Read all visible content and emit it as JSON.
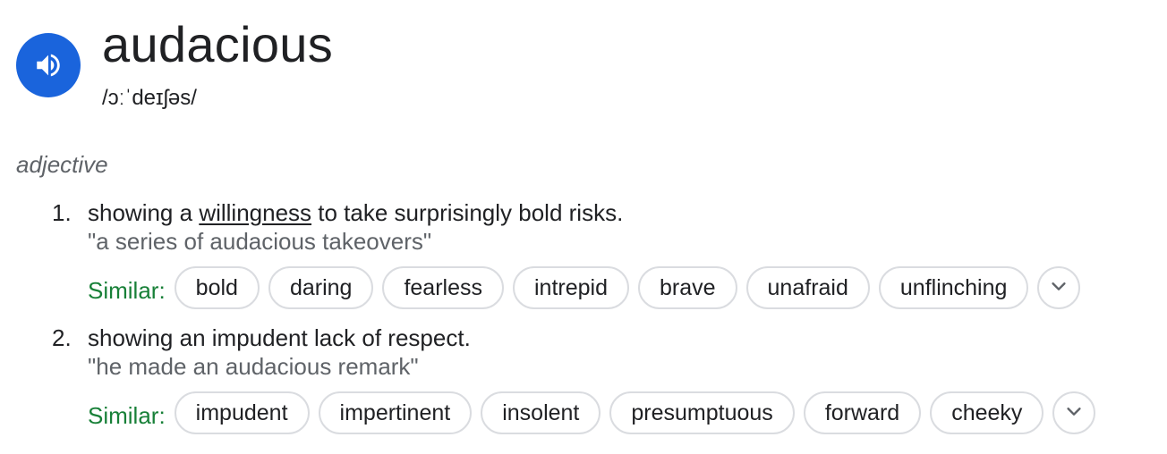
{
  "entry": {
    "word": "audacious",
    "phonetic": "/ɔːˈdeɪʃəs/",
    "part_of_speech": "adjective",
    "speaker_icon": "volume-up-icon",
    "accent_color": "#1a64dc"
  },
  "senses": [
    {
      "number": "1.",
      "def_before": "showing a ",
      "def_link": "willingness",
      "def_after": " to take surprisingly bold risks.",
      "example": "\"a series of audacious takeovers\"",
      "similar_label": "Similar:",
      "similar": [
        "bold",
        "daring",
        "fearless",
        "intrepid",
        "brave",
        "unafraid",
        "unflinching"
      ],
      "expand_icon": "chevron-down-icon"
    },
    {
      "number": "2.",
      "def_before": "showing an impudent lack of respect.",
      "def_link": "",
      "def_after": "",
      "example": "\"he made an audacious remark\"",
      "similar_label": "Similar:",
      "similar": [
        "impudent",
        "impertinent",
        "insolent",
        "presumptuous",
        "forward",
        "cheeky"
      ],
      "expand_icon": "chevron-down-icon"
    }
  ],
  "colors": {
    "text": "#202124",
    "muted": "#5f6368",
    "similar_label": "#188038",
    "chip_border": "#dadce0"
  }
}
